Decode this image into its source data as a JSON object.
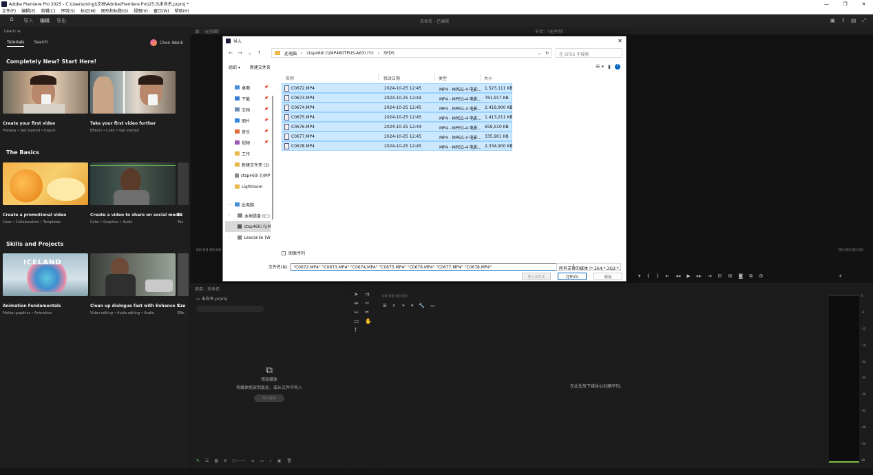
{
  "window": {
    "title": "Adobe Premiere Pro 2025 - C:\\Users\\mingi\\文档\\Adobe\\Premiere Pro\\25.0\\未命名.prproj *",
    "controls": [
      "—",
      "❐",
      "✕"
    ]
  },
  "menubar": [
    "文件(F)",
    "编辑(E)",
    "剪辑(C)",
    "序列(S)",
    "标记(M)",
    "图形和标题(G)",
    "视图(V)",
    "窗口(W)",
    "帮助(H)"
  ],
  "header": {
    "tabs": [
      "导入",
      "编辑",
      "导出"
    ],
    "center_text": "未命名 - 已编辑"
  },
  "learn": {
    "panel_title": "Learn",
    "tabs": [
      "Tutorials",
      "Search"
    ],
    "user": "Chen Wenk",
    "sections": [
      {
        "title": "Completely New? Start Here!",
        "cards": [
          {
            "title": "Create your first video",
            "sub": "Preview • Get started • Export"
          },
          {
            "title": "Take your first video further",
            "sub": "Effects • Color • Get started"
          }
        ]
      },
      {
        "title": "The Basics",
        "cards": [
          {
            "title": "Create a promotional video",
            "sub": "Color • Collaboration • Templates"
          },
          {
            "title": "Create a video to share on social media",
            "sub": "Color • Graphics • Audio"
          },
          {
            "title": "Di",
            "sub": "Tex"
          }
        ]
      },
      {
        "title": "Skills and Projects",
        "cards": [
          {
            "title": "Animation Fundamentals",
            "sub": "Motion graphics • Animation"
          },
          {
            "title": "Clean up dialogue fast with Enhance S...",
            "sub": "Video editing • Audio editing • Audio"
          },
          {
            "title": "Cre",
            "sub": "Effe"
          }
        ],
        "thumb_text": "ICELAND"
      }
    ]
  },
  "monitor": {
    "source_title": "源：（无剪辑）",
    "program_title": "节目：（无序列）",
    "timecode_left": "00:00:00:00",
    "timecode_right": "00:00:00:00"
  },
  "project": {
    "title": "项目：未命名",
    "bin": "未命名.prproj",
    "empty_title": "添加媒体",
    "empty_desc": "将媒体拖放到此处，或从文件中导入",
    "import_button": "导入媒体"
  },
  "timeline": {
    "timecode": "00:00:00:00",
    "message": "在此处放下媒体以创建序列。"
  },
  "meter": {
    "scale": [
      "0",
      "-6",
      "-12",
      "-18",
      "-24",
      "-30",
      "-36",
      "-42",
      "-48",
      "-54",
      "dB"
    ]
  },
  "dialog": {
    "title": "导入",
    "nav": [
      "←",
      "→",
      "⌄",
      "↑"
    ],
    "path": [
      "此电脑",
      "ctsp460i (\\\\MP460TPUS-A63) (Y:)",
      "SFDS"
    ],
    "search_placeholder": "在 SFDS 中搜索",
    "organize": "组织 ▾",
    "new_folder": "新建文件夹",
    "sidebar": [
      {
        "label": "桌面",
        "color": "#4a90d9"
      },
      {
        "label": "下载",
        "color": "#3a7bd5"
      },
      {
        "label": "文档",
        "color": "#6b8fb5"
      },
      {
        "label": "图片",
        "color": "#2e86de"
      },
      {
        "label": "音乐",
        "color": "#e06c3c"
      },
      {
        "label": "视频",
        "color": "#9b59b6"
      },
      {
        "label": "工作",
        "color": "#e8b84a"
      },
      {
        "label": "新建文件夹 (2)",
        "color": "#e8b84a"
      },
      {
        "label": "ctsp460i (\\\\MP460",
        "color": "#888888"
      },
      {
        "label": "Lightroom",
        "color": "#e8b84a"
      },
      {
        "label": "此电脑",
        "color": "#4a90d9"
      },
      {
        "label": "本地磁盘 (C:)",
        "color": "#888888"
      },
      {
        "label": "ctsp460i (\\\\MP",
        "color": "#555555"
      },
      {
        "label": "Lexcanile (W:)",
        "color": "#888888"
      }
    ],
    "columns": [
      "名称",
      "修改日期",
      "类型",
      "大小"
    ],
    "files": [
      {
        "name": "C0672.MP4",
        "date": "2024-10-25 12:45",
        "type": "MP4 - MPEG-4 电影...",
        "size": "1,523,111 KB"
      },
      {
        "name": "C0673.MP4",
        "date": "2024-10-25 12:44",
        "type": "MP4 - MPEG-4 电影...",
        "size": "761,917 KB"
      },
      {
        "name": "C0674.MP4",
        "date": "2024-10-25 12:45",
        "type": "MP4 - MPEG-4 电影...",
        "size": "2,419,900 KB"
      },
      {
        "name": "C0675.MP4",
        "date": "2024-10-25 12:45",
        "type": "MP4 - MPEG-4 电影...",
        "size": "1,413,211 KB"
      },
      {
        "name": "C0676.MP4",
        "date": "2024-10-25 12:44",
        "type": "MP4 - MPEG-4 电影...",
        "size": "659,510 KB"
      },
      {
        "name": "C0677.MP4",
        "date": "2024-10-25 12:45",
        "type": "MP4 - MPEG-4 电影...",
        "size": "335,901 KB"
      },
      {
        "name": "C0678.MP4",
        "date": "2024-10-25 12:45",
        "type": "MP4 - MPEG-4 电影...",
        "size": "2,334,900 KB"
      }
    ],
    "image_sequence": "图像序列",
    "filename_label": "文件名(N):",
    "filename_value": "\"C0672.MP4\" \"C0673.MP4\" \"C0674.MP4\" \"C0675.MP4\" \"C0676.MP4\" \"C0677.MP4\" \"C0678.MP4\"",
    "filetype_value": "所有支持的媒体 (*.264;*.3G2;*.",
    "buttons": {
      "import_folder": "导入文件夹",
      "open": "打开(O)",
      "cancel": "取消"
    }
  }
}
